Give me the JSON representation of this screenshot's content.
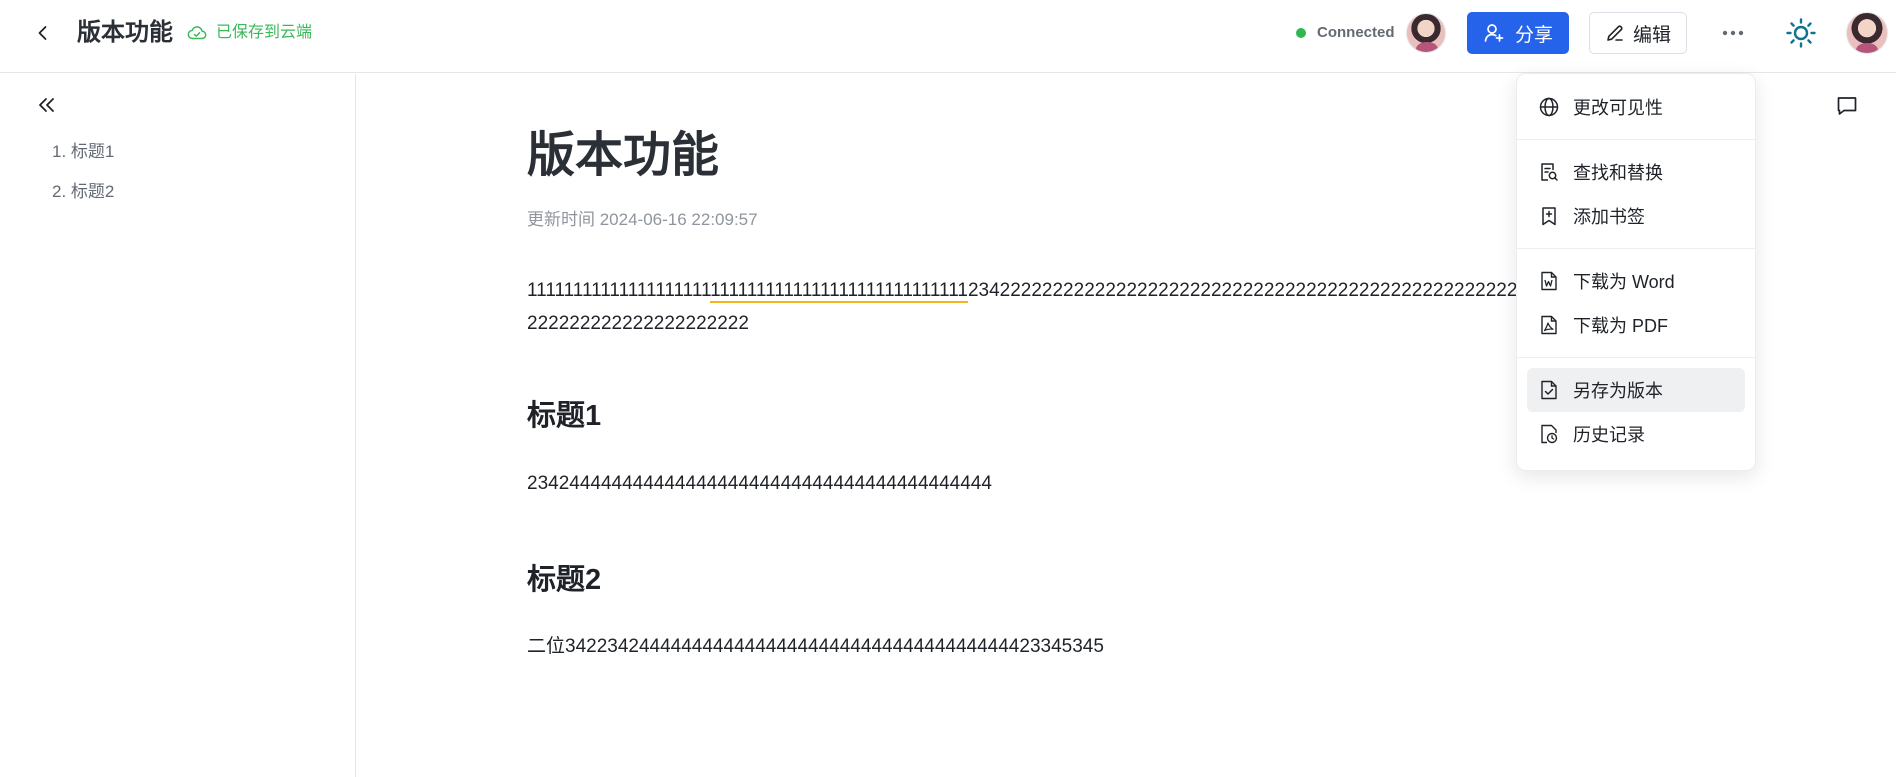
{
  "header": {
    "back_label": "",
    "title": "版本功能",
    "save_status": "已保存到云端",
    "connection_status": "Connected",
    "share_label": "分享",
    "edit_label": "编辑"
  },
  "colors": {
    "primary": "#2563eb",
    "success": "#3bb85a",
    "connected_dot": "#2fb84f",
    "highlight_underline": "#f5b41b"
  },
  "icons": {
    "back": "chevron-left-icon",
    "cloud": "cloud-icon",
    "share": "user-add-icon",
    "edit": "pencil-icon",
    "more": "ellipsis-icon",
    "theme": "sun-icon",
    "collapse": "double-chevron-left-icon",
    "comment": "comment-icon"
  },
  "toc": {
    "items": [
      {
        "label": "1. 标题1"
      },
      {
        "label": "2. 标题2"
      }
    ]
  },
  "document": {
    "title": "版本功能",
    "updated": "更新时间 2024-06-16 22:09:57",
    "para1_before": "11111111111111111111",
    "para1_underlined": "1111111111111111111111111111",
    "para1_after": "2342222222222222222222222222222222222222222222222222222222222222222222222",
    "heading1": "标题1",
    "para2": "23424444444444444444444444444444444444444444",
    "heading2": "标题2",
    "para3": "二位342234244444444444444444444444444444444444423345345"
  },
  "menu": {
    "items": [
      {
        "label": "更改可见性",
        "icon": "globe-icon"
      },
      {
        "label": "查找和替换",
        "icon": "find-replace-icon"
      },
      {
        "label": "添加书签",
        "icon": "bookmark-add-icon"
      },
      {
        "label": "下载为 Word",
        "icon": "word-file-icon"
      },
      {
        "label": "下载为 PDF",
        "icon": "pdf-file-icon"
      },
      {
        "label": "另存为版本",
        "icon": "save-version-icon"
      },
      {
        "label": "历史记录",
        "icon": "history-icon"
      }
    ]
  }
}
